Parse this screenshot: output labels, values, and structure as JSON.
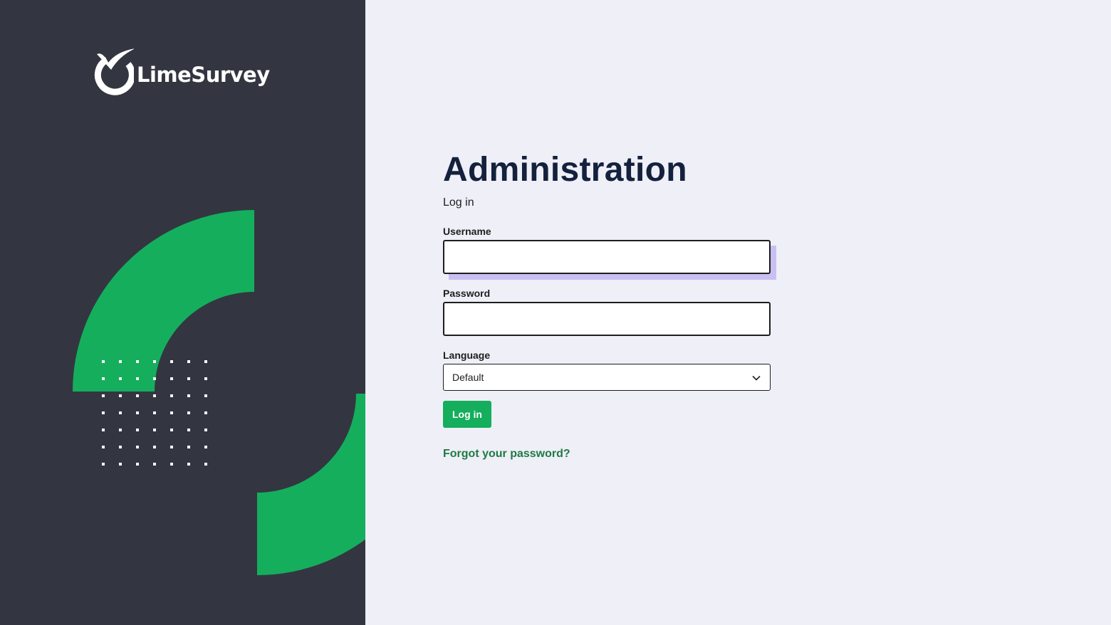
{
  "brand": {
    "name": "LimeSurvey",
    "panel_color": "#333641",
    "accent_green": "#14ae5c"
  },
  "main": {
    "title": "Administration",
    "subtitle": "Log in"
  },
  "form": {
    "username_label": "Username",
    "username_value": "",
    "password_label": "Password",
    "password_value": "",
    "language_label": "Language",
    "language_selected": "Default",
    "submit_label": "Log in",
    "forgot_link": "Forgot your password?"
  },
  "icons": {
    "logo": "limesurvey-logo-icon",
    "dropdown": "chevron-down-icon"
  }
}
